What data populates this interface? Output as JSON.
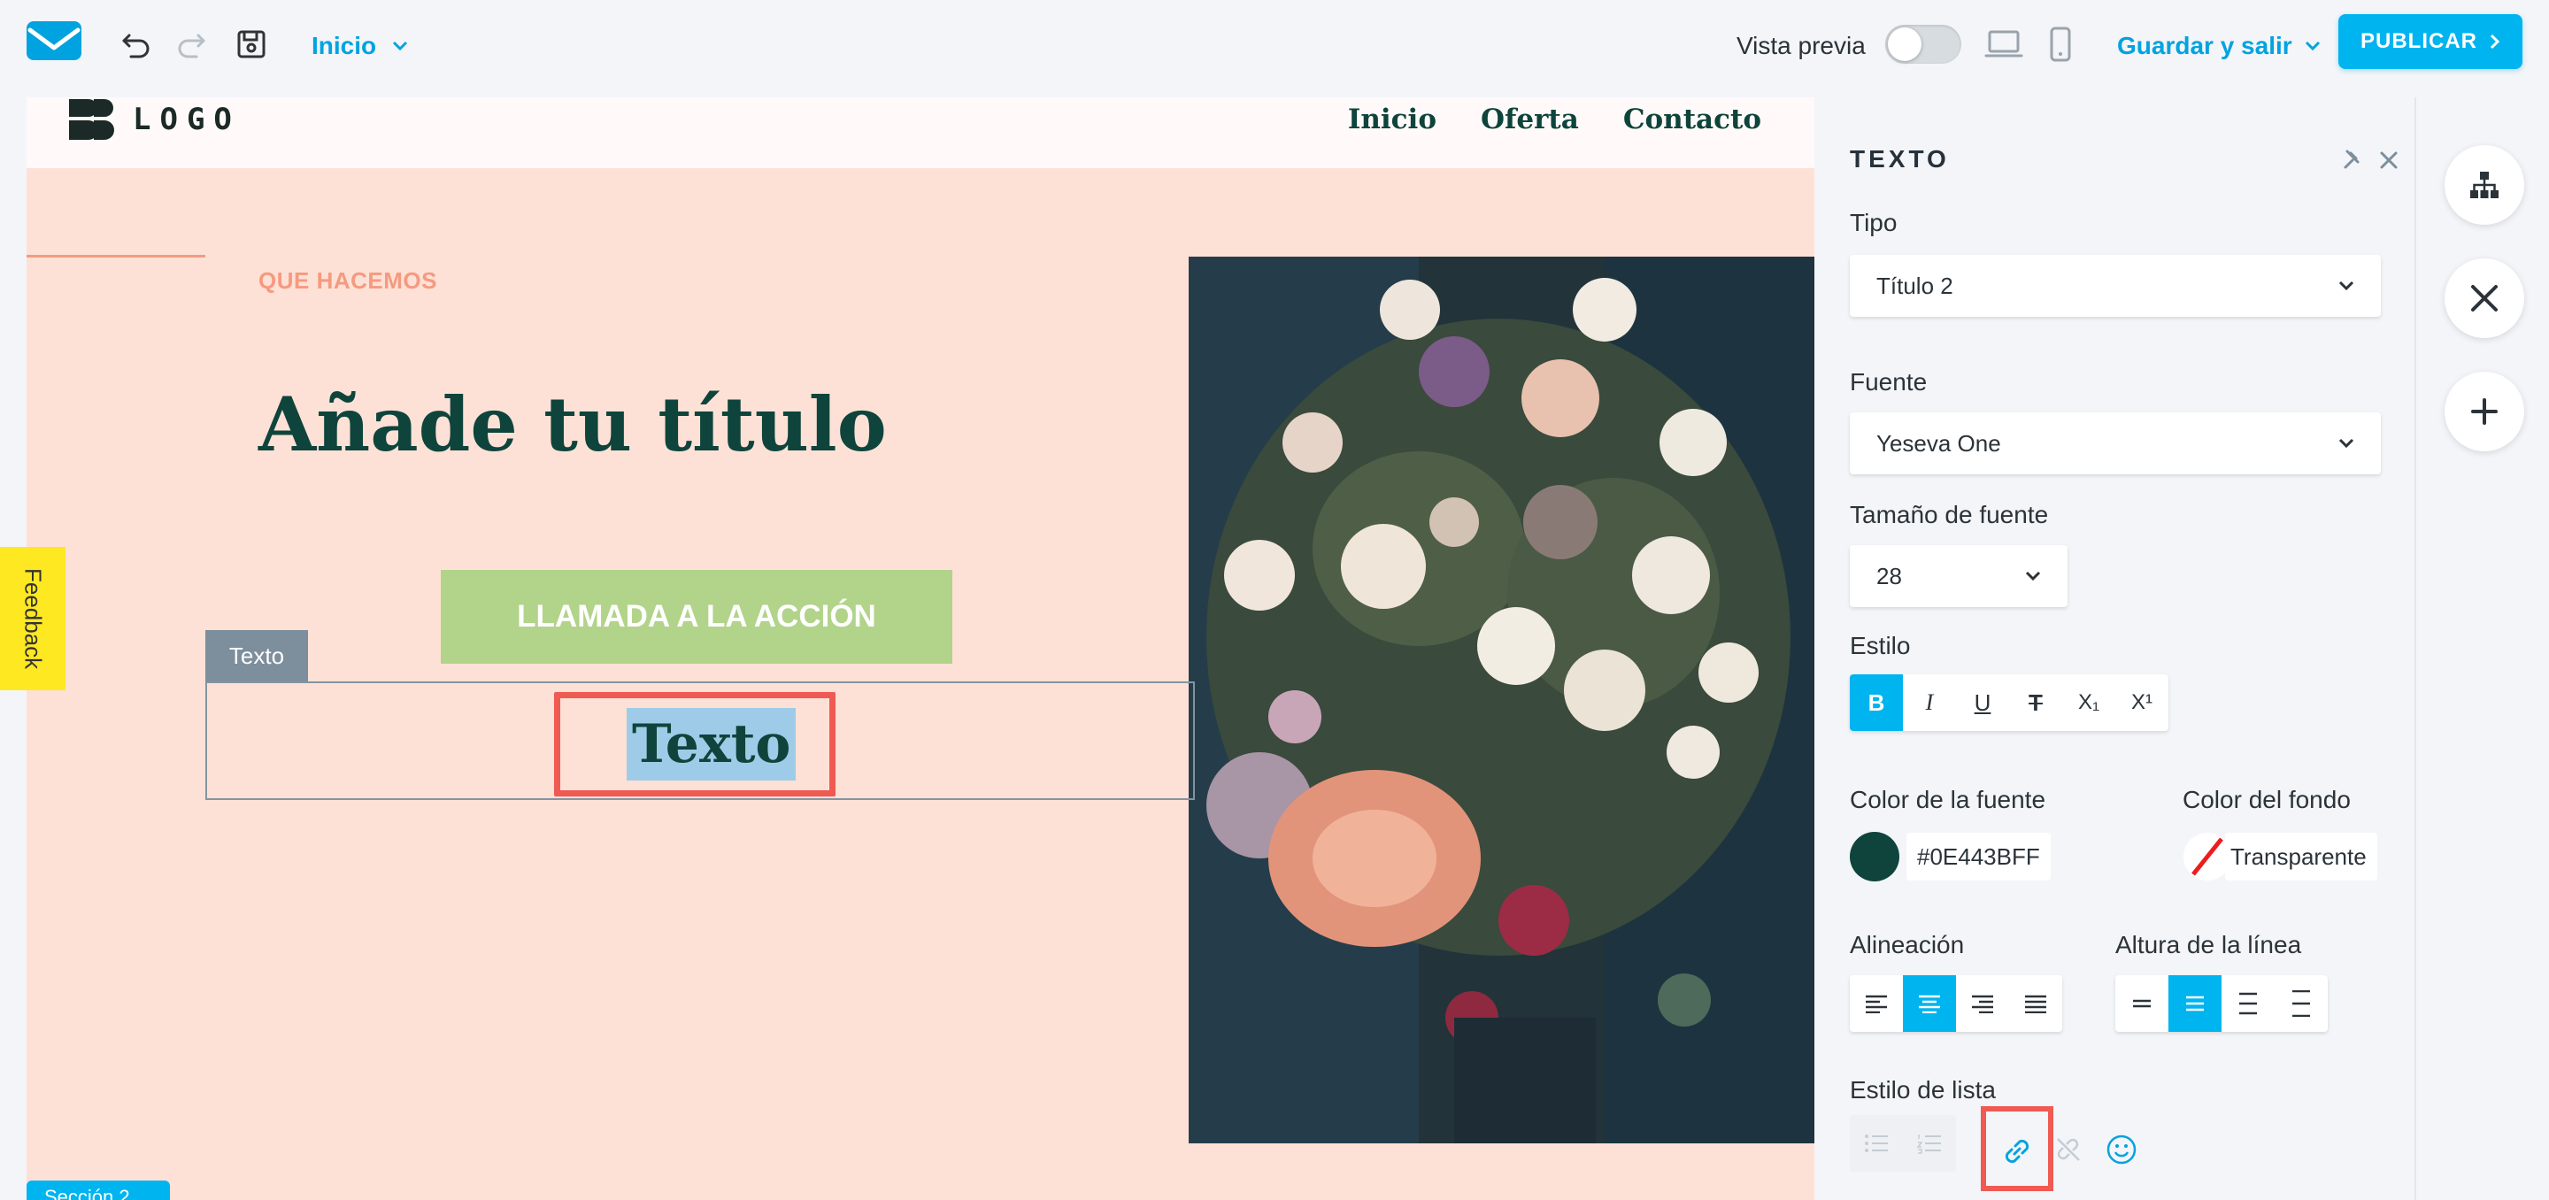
{
  "topbar": {
    "page_select": "Inicio",
    "preview_label": "Vista previa",
    "save_exit": "Guardar y salir",
    "publish": "PUBLICAR"
  },
  "site": {
    "logo_text": "LOGO",
    "nav": [
      "Inicio",
      "Oferta",
      "Contacto"
    ],
    "eyebrow": "QUE HACEMOS",
    "title": "Añade tu título",
    "cta": "LLAMADA A LA ACCIÓN",
    "text_tag": "Texto",
    "selected_text": "Texto",
    "section_tab": "Sección 2"
  },
  "feedback": "Feedback",
  "panel": {
    "title": "TEXTO",
    "type_label": "Tipo",
    "type_value": "Título 2",
    "font_label": "Fuente",
    "font_value": "Yeseva One",
    "size_label": "Tamaño de fuente",
    "size_value": "28",
    "style_label": "Estilo",
    "style_buttons": [
      "B",
      "I",
      "U",
      "T",
      "X₁",
      "X¹"
    ],
    "font_color_label": "Color de la fuente",
    "font_color_value": "#0E443BFF",
    "bg_color_label": "Color del fondo",
    "bg_color_value": "Transparente",
    "align_label": "Alineación",
    "line_height_label": "Altura de la línea",
    "list_label": "Estilo de lista"
  },
  "colors": {
    "accent": "#00b4ef",
    "dark_green": "#0e443b",
    "canvas_bg": "#fee1d6",
    "cta_bg": "#b2d38a",
    "highlight": "#ef5a52"
  }
}
